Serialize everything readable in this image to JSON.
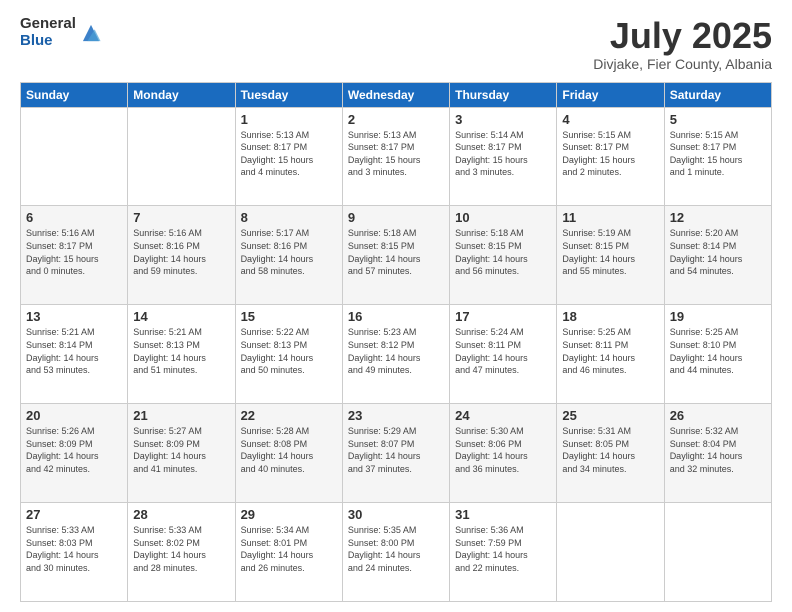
{
  "logo": {
    "general": "General",
    "blue": "Blue"
  },
  "header": {
    "month": "July 2025",
    "location": "Divjake, Fier County, Albania"
  },
  "weekdays": [
    "Sunday",
    "Monday",
    "Tuesday",
    "Wednesday",
    "Thursday",
    "Friday",
    "Saturday"
  ],
  "weeks": [
    [
      {
        "day": "",
        "info": ""
      },
      {
        "day": "",
        "info": ""
      },
      {
        "day": "1",
        "info": "Sunrise: 5:13 AM\nSunset: 8:17 PM\nDaylight: 15 hours\nand 4 minutes."
      },
      {
        "day": "2",
        "info": "Sunrise: 5:13 AM\nSunset: 8:17 PM\nDaylight: 15 hours\nand 3 minutes."
      },
      {
        "day": "3",
        "info": "Sunrise: 5:14 AM\nSunset: 8:17 PM\nDaylight: 15 hours\nand 3 minutes."
      },
      {
        "day": "4",
        "info": "Sunrise: 5:15 AM\nSunset: 8:17 PM\nDaylight: 15 hours\nand 2 minutes."
      },
      {
        "day": "5",
        "info": "Sunrise: 5:15 AM\nSunset: 8:17 PM\nDaylight: 15 hours\nand 1 minute."
      }
    ],
    [
      {
        "day": "6",
        "info": "Sunrise: 5:16 AM\nSunset: 8:17 PM\nDaylight: 15 hours\nand 0 minutes."
      },
      {
        "day": "7",
        "info": "Sunrise: 5:16 AM\nSunset: 8:16 PM\nDaylight: 14 hours\nand 59 minutes."
      },
      {
        "day": "8",
        "info": "Sunrise: 5:17 AM\nSunset: 8:16 PM\nDaylight: 14 hours\nand 58 minutes."
      },
      {
        "day": "9",
        "info": "Sunrise: 5:18 AM\nSunset: 8:15 PM\nDaylight: 14 hours\nand 57 minutes."
      },
      {
        "day": "10",
        "info": "Sunrise: 5:18 AM\nSunset: 8:15 PM\nDaylight: 14 hours\nand 56 minutes."
      },
      {
        "day": "11",
        "info": "Sunrise: 5:19 AM\nSunset: 8:15 PM\nDaylight: 14 hours\nand 55 minutes."
      },
      {
        "day": "12",
        "info": "Sunrise: 5:20 AM\nSunset: 8:14 PM\nDaylight: 14 hours\nand 54 minutes."
      }
    ],
    [
      {
        "day": "13",
        "info": "Sunrise: 5:21 AM\nSunset: 8:14 PM\nDaylight: 14 hours\nand 53 minutes."
      },
      {
        "day": "14",
        "info": "Sunrise: 5:21 AM\nSunset: 8:13 PM\nDaylight: 14 hours\nand 51 minutes."
      },
      {
        "day": "15",
        "info": "Sunrise: 5:22 AM\nSunset: 8:13 PM\nDaylight: 14 hours\nand 50 minutes."
      },
      {
        "day": "16",
        "info": "Sunrise: 5:23 AM\nSunset: 8:12 PM\nDaylight: 14 hours\nand 49 minutes."
      },
      {
        "day": "17",
        "info": "Sunrise: 5:24 AM\nSunset: 8:11 PM\nDaylight: 14 hours\nand 47 minutes."
      },
      {
        "day": "18",
        "info": "Sunrise: 5:25 AM\nSunset: 8:11 PM\nDaylight: 14 hours\nand 46 minutes."
      },
      {
        "day": "19",
        "info": "Sunrise: 5:25 AM\nSunset: 8:10 PM\nDaylight: 14 hours\nand 44 minutes."
      }
    ],
    [
      {
        "day": "20",
        "info": "Sunrise: 5:26 AM\nSunset: 8:09 PM\nDaylight: 14 hours\nand 42 minutes."
      },
      {
        "day": "21",
        "info": "Sunrise: 5:27 AM\nSunset: 8:09 PM\nDaylight: 14 hours\nand 41 minutes."
      },
      {
        "day": "22",
        "info": "Sunrise: 5:28 AM\nSunset: 8:08 PM\nDaylight: 14 hours\nand 40 minutes."
      },
      {
        "day": "23",
        "info": "Sunrise: 5:29 AM\nSunset: 8:07 PM\nDaylight: 14 hours\nand 37 minutes."
      },
      {
        "day": "24",
        "info": "Sunrise: 5:30 AM\nSunset: 8:06 PM\nDaylight: 14 hours\nand 36 minutes."
      },
      {
        "day": "25",
        "info": "Sunrise: 5:31 AM\nSunset: 8:05 PM\nDaylight: 14 hours\nand 34 minutes."
      },
      {
        "day": "26",
        "info": "Sunrise: 5:32 AM\nSunset: 8:04 PM\nDaylight: 14 hours\nand 32 minutes."
      }
    ],
    [
      {
        "day": "27",
        "info": "Sunrise: 5:33 AM\nSunset: 8:03 PM\nDaylight: 14 hours\nand 30 minutes."
      },
      {
        "day": "28",
        "info": "Sunrise: 5:33 AM\nSunset: 8:02 PM\nDaylight: 14 hours\nand 28 minutes."
      },
      {
        "day": "29",
        "info": "Sunrise: 5:34 AM\nSunset: 8:01 PM\nDaylight: 14 hours\nand 26 minutes."
      },
      {
        "day": "30",
        "info": "Sunrise: 5:35 AM\nSunset: 8:00 PM\nDaylight: 14 hours\nand 24 minutes."
      },
      {
        "day": "31",
        "info": "Sunrise: 5:36 AM\nSunset: 7:59 PM\nDaylight: 14 hours\nand 22 minutes."
      },
      {
        "day": "",
        "info": ""
      },
      {
        "day": "",
        "info": ""
      }
    ]
  ]
}
